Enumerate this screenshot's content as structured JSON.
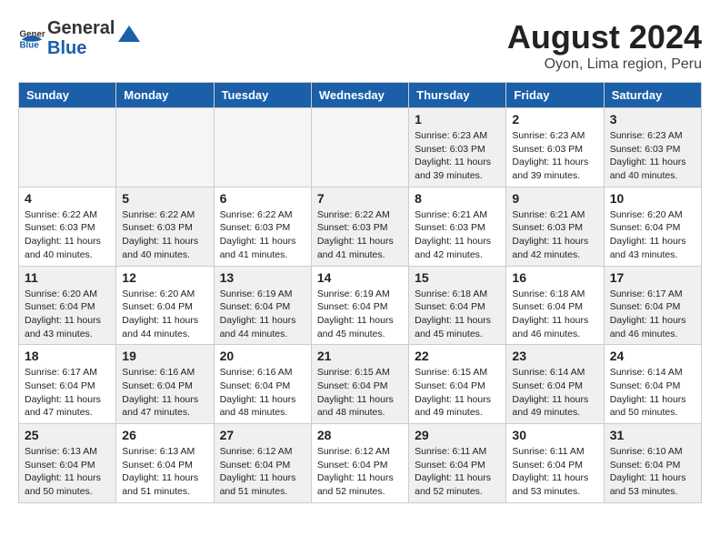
{
  "header": {
    "logo_general": "General",
    "logo_blue": "Blue",
    "month_title": "August 2024",
    "location": "Oyon, Lima region, Peru"
  },
  "days_of_week": [
    "Sunday",
    "Monday",
    "Tuesday",
    "Wednesday",
    "Thursday",
    "Friday",
    "Saturday"
  ],
  "weeks": [
    [
      {
        "day": "",
        "info": "",
        "empty": true
      },
      {
        "day": "",
        "info": "",
        "empty": true
      },
      {
        "day": "",
        "info": "",
        "empty": true
      },
      {
        "day": "",
        "info": "",
        "empty": true
      },
      {
        "day": "1",
        "info": "Sunrise: 6:23 AM\nSunset: 6:03 PM\nDaylight: 11 hours\nand 39 minutes."
      },
      {
        "day": "2",
        "info": "Sunrise: 6:23 AM\nSunset: 6:03 PM\nDaylight: 11 hours\nand 39 minutes."
      },
      {
        "day": "3",
        "info": "Sunrise: 6:23 AM\nSunset: 6:03 PM\nDaylight: 11 hours\nand 40 minutes."
      }
    ],
    [
      {
        "day": "4",
        "info": "Sunrise: 6:22 AM\nSunset: 6:03 PM\nDaylight: 11 hours\nand 40 minutes."
      },
      {
        "day": "5",
        "info": "Sunrise: 6:22 AM\nSunset: 6:03 PM\nDaylight: 11 hours\nand 40 minutes."
      },
      {
        "day": "6",
        "info": "Sunrise: 6:22 AM\nSunset: 6:03 PM\nDaylight: 11 hours\nand 41 minutes."
      },
      {
        "day": "7",
        "info": "Sunrise: 6:22 AM\nSunset: 6:03 PM\nDaylight: 11 hours\nand 41 minutes."
      },
      {
        "day": "8",
        "info": "Sunrise: 6:21 AM\nSunset: 6:03 PM\nDaylight: 11 hours\nand 42 minutes."
      },
      {
        "day": "9",
        "info": "Sunrise: 6:21 AM\nSunset: 6:03 PM\nDaylight: 11 hours\nand 42 minutes."
      },
      {
        "day": "10",
        "info": "Sunrise: 6:20 AM\nSunset: 6:04 PM\nDaylight: 11 hours\nand 43 minutes."
      }
    ],
    [
      {
        "day": "11",
        "info": "Sunrise: 6:20 AM\nSunset: 6:04 PM\nDaylight: 11 hours\nand 43 minutes."
      },
      {
        "day": "12",
        "info": "Sunrise: 6:20 AM\nSunset: 6:04 PM\nDaylight: 11 hours\nand 44 minutes."
      },
      {
        "day": "13",
        "info": "Sunrise: 6:19 AM\nSunset: 6:04 PM\nDaylight: 11 hours\nand 44 minutes."
      },
      {
        "day": "14",
        "info": "Sunrise: 6:19 AM\nSunset: 6:04 PM\nDaylight: 11 hours\nand 45 minutes."
      },
      {
        "day": "15",
        "info": "Sunrise: 6:18 AM\nSunset: 6:04 PM\nDaylight: 11 hours\nand 45 minutes."
      },
      {
        "day": "16",
        "info": "Sunrise: 6:18 AM\nSunset: 6:04 PM\nDaylight: 11 hours\nand 46 minutes."
      },
      {
        "day": "17",
        "info": "Sunrise: 6:17 AM\nSunset: 6:04 PM\nDaylight: 11 hours\nand 46 minutes."
      }
    ],
    [
      {
        "day": "18",
        "info": "Sunrise: 6:17 AM\nSunset: 6:04 PM\nDaylight: 11 hours\nand 47 minutes."
      },
      {
        "day": "19",
        "info": "Sunrise: 6:16 AM\nSunset: 6:04 PM\nDaylight: 11 hours\nand 47 minutes."
      },
      {
        "day": "20",
        "info": "Sunrise: 6:16 AM\nSunset: 6:04 PM\nDaylight: 11 hours\nand 48 minutes."
      },
      {
        "day": "21",
        "info": "Sunrise: 6:15 AM\nSunset: 6:04 PM\nDaylight: 11 hours\nand 48 minutes."
      },
      {
        "day": "22",
        "info": "Sunrise: 6:15 AM\nSunset: 6:04 PM\nDaylight: 11 hours\nand 49 minutes."
      },
      {
        "day": "23",
        "info": "Sunrise: 6:14 AM\nSunset: 6:04 PM\nDaylight: 11 hours\nand 49 minutes."
      },
      {
        "day": "24",
        "info": "Sunrise: 6:14 AM\nSunset: 6:04 PM\nDaylight: 11 hours\nand 50 minutes."
      }
    ],
    [
      {
        "day": "25",
        "info": "Sunrise: 6:13 AM\nSunset: 6:04 PM\nDaylight: 11 hours\nand 50 minutes."
      },
      {
        "day": "26",
        "info": "Sunrise: 6:13 AM\nSunset: 6:04 PM\nDaylight: 11 hours\nand 51 minutes."
      },
      {
        "day": "27",
        "info": "Sunrise: 6:12 AM\nSunset: 6:04 PM\nDaylight: 11 hours\nand 51 minutes."
      },
      {
        "day": "28",
        "info": "Sunrise: 6:12 AM\nSunset: 6:04 PM\nDaylight: 11 hours\nand 52 minutes."
      },
      {
        "day": "29",
        "info": "Sunrise: 6:11 AM\nSunset: 6:04 PM\nDaylight: 11 hours\nand 52 minutes."
      },
      {
        "day": "30",
        "info": "Sunrise: 6:11 AM\nSunset: 6:04 PM\nDaylight: 11 hours\nand 53 minutes."
      },
      {
        "day": "31",
        "info": "Sunrise: 6:10 AM\nSunset: 6:04 PM\nDaylight: 11 hours\nand 53 minutes."
      }
    ]
  ]
}
